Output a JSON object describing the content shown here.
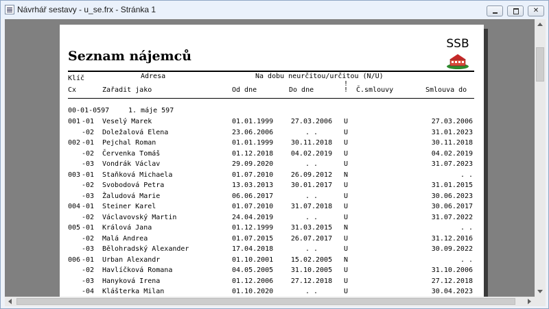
{
  "window": {
    "title": "Návrhář sestavy - u_se.frx - Stránka 1"
  },
  "report": {
    "title": "Seznam nájemců",
    "logo_text": "SSB",
    "headers": {
      "klic": "Klíč",
      "adresa": "Adresa",
      "na_dobu": "Na dobu neurčitou/určitou (N/U)",
      "excl": "!",
      "cx": "Cx",
      "zaradit": "Zařadit jako",
      "od_dne": "Od dne",
      "do_dne": "Do dne",
      "excl2": "!",
      "c_smlouvy": "Č.smlouvy",
      "smlouva_do": "Smlouva do"
    },
    "group_header": {
      "key": "00-01-0597",
      "address": "1. máje 597"
    },
    "rows": [
      {
        "id": "001",
        "cx": "-01",
        "name": "Veselý Marek",
        "od": "01.01.1999",
        "do": "27.03.2006",
        "nu": "U",
        "smlouva_do": "27.03.2006"
      },
      {
        "id": "",
        "cx": "-02",
        "name": "Doležalová Elena",
        "od": "23.06.2006",
        "do": ".  .",
        "nu": "U",
        "smlouva_do": "31.01.2023"
      },
      {
        "id": "002",
        "cx": "-01",
        "name": "Pejchal Roman",
        "od": "01.01.1999",
        "do": "30.11.2018",
        "nu": "U",
        "smlouva_do": "30.11.2018"
      },
      {
        "id": "",
        "cx": "-02",
        "name": "Červenka Tomáš",
        "od": "01.12.2018",
        "do": "04.02.2019",
        "nu": "U",
        "smlouva_do": "04.02.2019"
      },
      {
        "id": "",
        "cx": "-03",
        "name": "Vondrák Václav",
        "od": "29.09.2020",
        "do": ".  .",
        "nu": "U",
        "smlouva_do": "31.07.2023"
      },
      {
        "id": "003",
        "cx": "-01",
        "name": "Staňková Michaela",
        "od": "01.07.2010",
        "do": "26.09.2012",
        "nu": "N",
        "smlouva_do": ".  ."
      },
      {
        "id": "",
        "cx": "-02",
        "name": "Svobodová Petra",
        "od": "13.03.2013",
        "do": "30.01.2017",
        "nu": "U",
        "smlouva_do": "31.01.2015"
      },
      {
        "id": "",
        "cx": "-03",
        "name": "Žaludová Marie",
        "od": "06.06.2017",
        "do": ".  .",
        "nu": "U",
        "smlouva_do": "30.06.2023"
      },
      {
        "id": "004",
        "cx": "-01",
        "name": "Steiner Karel",
        "od": "01.07.2010",
        "do": "31.07.2018",
        "nu": "U",
        "smlouva_do": "30.06.2017"
      },
      {
        "id": "",
        "cx": "-02",
        "name": "Václavovský Martin",
        "od": "24.04.2019",
        "do": ".  .",
        "nu": "U",
        "smlouva_do": "31.07.2022"
      },
      {
        "id": "005",
        "cx": "-01",
        "name": "Králová Jana",
        "od": "01.12.1999",
        "do": "31.03.2015",
        "nu": "N",
        "smlouva_do": ".  ."
      },
      {
        "id": "",
        "cx": "-02",
        "name": "Malá Andrea",
        "od": "01.07.2015",
        "do": "26.07.2017",
        "nu": "U",
        "smlouva_do": "31.12.2016"
      },
      {
        "id": "",
        "cx": "-03",
        "name": "Bělohradský Alexander",
        "od": "17.04.2018",
        "do": ".  .",
        "nu": "U",
        "smlouva_do": "30.09.2022"
      },
      {
        "id": "006",
        "cx": "-01",
        "name": "Urban Alexandr",
        "od": "01.10.2001",
        "do": "15.02.2005",
        "nu": "N",
        "smlouva_do": ".  ."
      },
      {
        "id": "",
        "cx": "-02",
        "name": "Havlíčková Romana",
        "od": "04.05.2005",
        "do": "31.10.2005",
        "nu": "U",
        "smlouva_do": "31.10.2006"
      },
      {
        "id": "",
        "cx": "-03",
        "name": "Hanyková Irena",
        "od": "01.12.2006",
        "do": "27.12.2018",
        "nu": "U",
        "smlouva_do": "27.12.2018"
      },
      {
        "id": "",
        "cx": "-04",
        "name": "Klášterka Milan",
        "od": "01.10.2020",
        "do": ".  .",
        "nu": "U",
        "smlouva_do": "30.04.2023"
      }
    ]
  }
}
